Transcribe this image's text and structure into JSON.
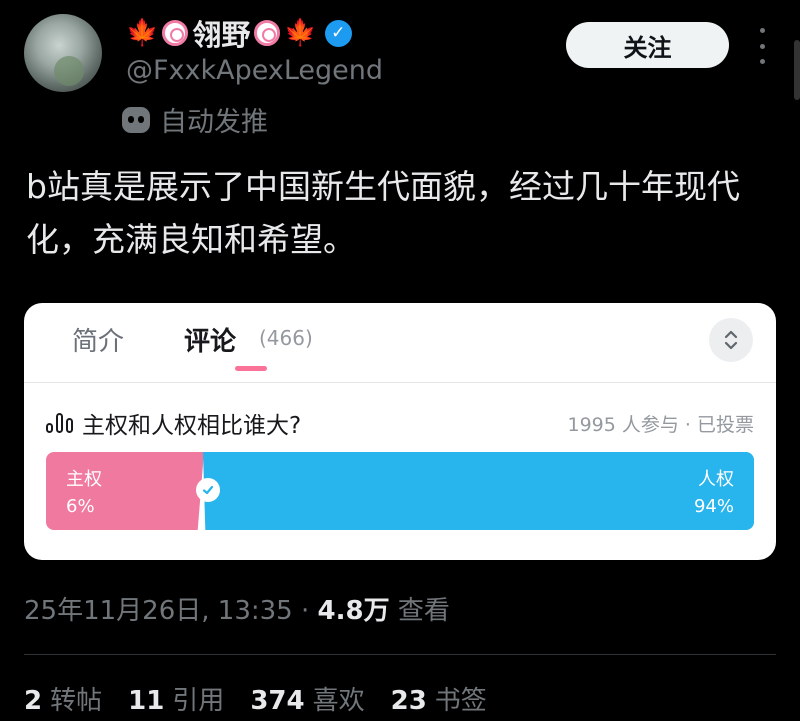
{
  "author": {
    "display_name": "翎野",
    "handle": "@FxxkApexLegend",
    "automated_label": "自动发推",
    "name_emoji_left": "🍁",
    "name_emoji_right": "🍁",
    "verified_icon": "check-badge-icon"
  },
  "follow_button": {
    "label": "关注"
  },
  "tweet_text": "b站真是展示了中国新生代面貌，经过几十年现代化，充满良知和希望。",
  "card": {
    "tabs": [
      {
        "label": "简介",
        "active": false
      },
      {
        "label": "评论",
        "active": true,
        "count": "(466)"
      }
    ],
    "accent_color": "#fb7299",
    "poll": {
      "question": "主权和人权相比谁大?",
      "meta": "1995 人参与 · 已投票",
      "options": [
        {
          "label": "主权",
          "percent": "6%",
          "share": 0.06,
          "color": "#f0799f",
          "voted": false
        },
        {
          "label": "人权",
          "percent": "94%",
          "share": 0.94,
          "color": "#28b4ec",
          "voted": true
        }
      ]
    }
  },
  "timestamp": {
    "datetime": "25年11月26日, 13:35",
    "separator": "·",
    "views_value": "4.8万",
    "views_label": "查看"
  },
  "stats": [
    {
      "value": "2",
      "label": "转帖"
    },
    {
      "value": "11",
      "label": "引用"
    },
    {
      "value": "374",
      "label": "喜欢"
    },
    {
      "value": "23",
      "label": "书签"
    }
  ]
}
